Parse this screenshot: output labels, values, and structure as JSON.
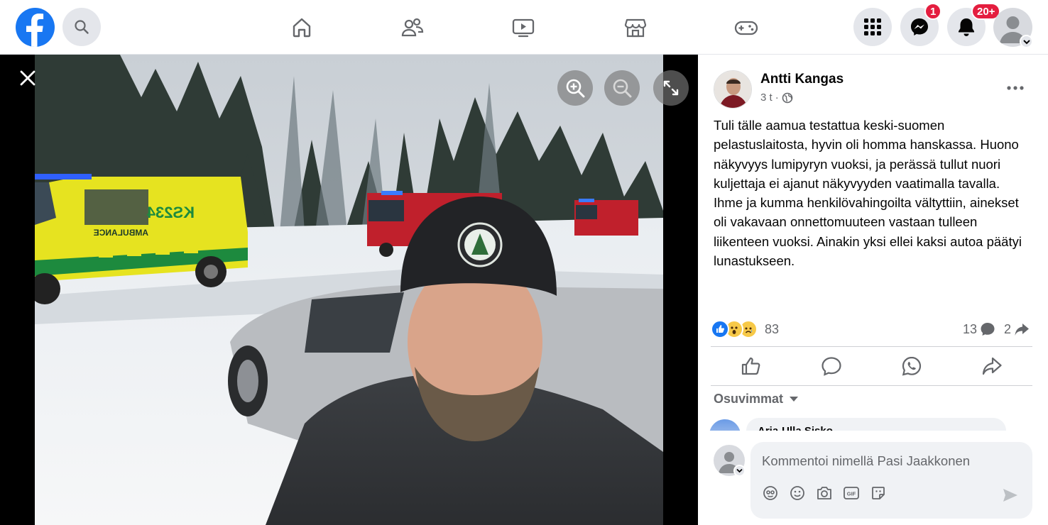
{
  "topbar": {
    "brand_icon": "facebook-logo",
    "search_icon": "search-icon",
    "nav_tabs": [
      {
        "name": "home",
        "icon": "home-icon"
      },
      {
        "name": "friends",
        "icon": "friends-icon"
      },
      {
        "name": "watch",
        "icon": "video-icon"
      },
      {
        "name": "marketplace",
        "icon": "store-icon"
      },
      {
        "name": "gaming",
        "icon": "gamepad-icon"
      }
    ],
    "menu_icon": "grid-icon",
    "messenger_badge": "1",
    "notifications_badge": "20+",
    "colors": {
      "brand": "#1877f2",
      "badge": "#e41e3f"
    }
  },
  "viewer": {
    "close_icon": "close-icon",
    "zoom_in_icon": "zoom-in-icon",
    "zoom_out_icon": "zoom-out-icon",
    "fullscreen_icon": "fullscreen-icon",
    "photo_ambulance_plate": "KS234",
    "photo_ambulance_text": "AMBULANCE"
  },
  "post": {
    "author": "Antti Kangas",
    "time": "3 t",
    "separator": "·",
    "audience_icon": "globe-icon",
    "text": "Tuli tälle aamua testattua keski-suomen pelastuslaitosta, hyvin oli homma hanskassa. Huono näkyvyys lumipyryn vuoksi, ja perässä tullut nuori kuljettaja ei ajanut näkyvyyden vaatimalla tavalla. Ihme ja kumma henkilövahingoilta vältyttiin, ainekset oli vakavaan onnettomuuteen vastaan tulleen liikenteen vuoksi. Ainakin yksi ellei kaksi autoa päätyi lunastukseen.",
    "reaction_count": "83",
    "comment_count": "13",
    "share_count": "2",
    "sort_label": "Osuvimmat",
    "partial_comment_name": "Arja-Ulla Sisko"
  },
  "composer": {
    "placeholder": "Kommentoi nimellä Pasi Jaakkonen"
  }
}
